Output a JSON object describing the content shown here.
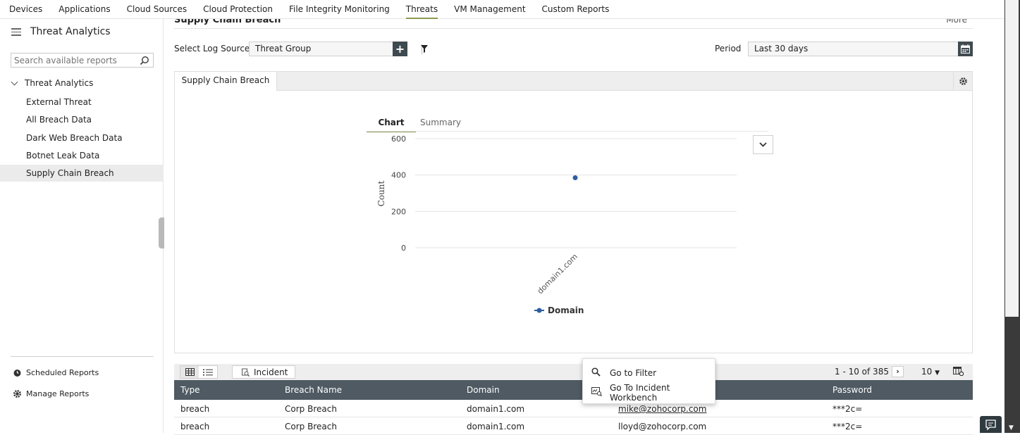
{
  "topnav": {
    "items": [
      "Devices",
      "Applications",
      "Cloud Sources",
      "Cloud Protection",
      "File Integrity Monitoring",
      "Threats",
      "VM Management",
      "Custom Reports"
    ],
    "active": "Threats"
  },
  "sidebar": {
    "title": "Threat Analytics",
    "search_placeholder": "Search available reports",
    "group_label": "Threat Analytics",
    "items": [
      {
        "label": "External Threat"
      },
      {
        "label": "All Breach Data"
      },
      {
        "label": "Dark Web Breach Data"
      },
      {
        "label": "Botnet Leak Data"
      },
      {
        "label": "Supply Chain Breach"
      }
    ],
    "active_item": "Supply Chain Breach",
    "links": {
      "scheduled": "Scheduled Reports",
      "manage": "Manage Reports"
    }
  },
  "header": {
    "cut_title": "Supply Chain Breach",
    "right_cut_text": "More"
  },
  "filters": {
    "log_source_label": "Select Log Source",
    "log_source_value": "Threat Group",
    "period_label": "Period",
    "period_value": "Last 30 days"
  },
  "panel": {
    "tab_label": "Supply Chain Breach"
  },
  "chart_tabs": {
    "chart": "Chart",
    "summary": "Summary"
  },
  "chart_data": {
    "type": "line",
    "categories": [
      "domain1.com"
    ],
    "series": [
      {
        "name": "Domain",
        "values": [
          385
        ],
        "color": "#2d5e9e"
      }
    ],
    "ylabel": "Count",
    "xlabel": "",
    "ylim": [
      0,
      600
    ],
    "yticks": [
      0,
      200,
      400,
      600
    ],
    "grid": true,
    "legend": "bottom-center"
  },
  "table_toolbar": {
    "incident_label": "Incident",
    "pagination": "1 - 10 of 385",
    "page_size": "10"
  },
  "table": {
    "columns": [
      "Type",
      "Breach Name",
      "Domain",
      "",
      "Password"
    ],
    "rows": [
      [
        "breach",
        "Corp Breach",
        "domain1.com",
        "mike@zohocorp.com",
        "***2c="
      ],
      [
        "breach",
        "Corp Breach",
        "domain1.com",
        "lloyd@zohocorp.com",
        "***2c="
      ]
    ]
  },
  "context_menu": {
    "items": [
      "Go to Filter",
      "Go To Incident Workbench"
    ]
  }
}
